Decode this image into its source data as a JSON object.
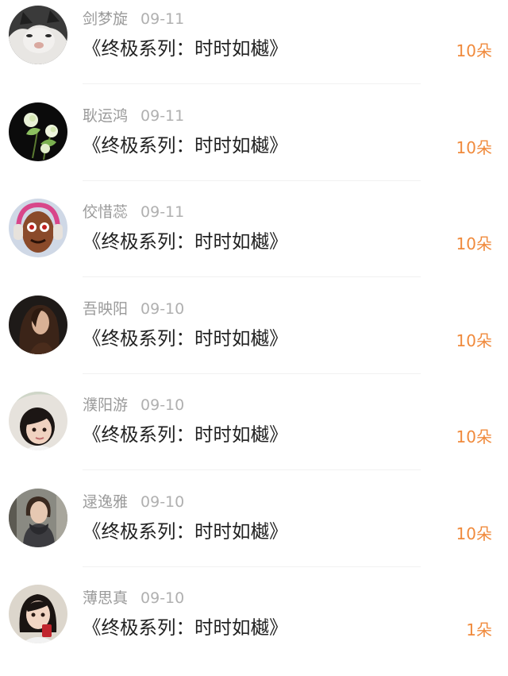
{
  "colors": {
    "name_text": "#9a9a9a",
    "date_text": "#b0b0b0",
    "title_text": "#222222",
    "amount_accent": "#f08a3c",
    "divider": "#f1f1f1"
  },
  "items": [
    {
      "name": "剑梦旋",
      "date": "09-11",
      "title": "《终极系列：时时如樾》",
      "amount": "10朵",
      "avatar_icon": "cat-photo-avatar-icon"
    },
    {
      "name": "耿运鸿",
      "date": "09-11",
      "title": "《终极系列：时时如樾》",
      "amount": "10朵",
      "avatar_icon": "flower-photo-avatar-icon"
    },
    {
      "name": "佼惜蕊",
      "date": "09-11",
      "title": "《终极系列：时时如樾》",
      "amount": "10朵",
      "avatar_icon": "cartoon-headphones-avatar-icon"
    },
    {
      "name": "吾映阳",
      "date": "09-10",
      "title": "《终极系列：时时如樾》",
      "amount": "10朵",
      "avatar_icon": "woman-long-hair-avatar-icon"
    },
    {
      "name": "濮阳游",
      "date": "09-10",
      "title": "《终极系列：时时如樾》",
      "amount": "10朵",
      "avatar_icon": "child-photo-avatar-icon"
    },
    {
      "name": "逯逸雅",
      "date": "09-10",
      "title": "《终极系列：时时如樾》",
      "amount": "10朵",
      "avatar_icon": "woman-scarf-avatar-icon"
    },
    {
      "name": "薄思真",
      "date": "09-10",
      "title": "《终极系列：时时如樾》",
      "amount": "1朵",
      "avatar_icon": "girl-photo-avatar-icon"
    }
  ]
}
